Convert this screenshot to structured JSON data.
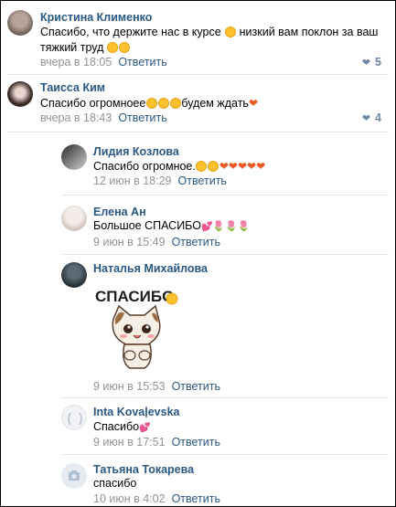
{
  "comments": [
    {
      "author": "Кристина Клименко",
      "text_line1": "Спасибо, что держите нас в курсе",
      "text_line1b": "низкий вам поклон за ваш",
      "text_line2": "тяжкий труд",
      "time": "вчера в 18:05",
      "reply": "Ответить",
      "likes": "5"
    },
    {
      "author": "Таисса Ким",
      "text_a": "Спасибо огромнoee",
      "text_b": "будем ждать",
      "time": "вчера в 18:43",
      "reply": "Ответить",
      "likes": "4"
    }
  ],
  "replies": [
    {
      "author": "Лидия Козлова",
      "text": "Спасибо огромное.",
      "time": "12 июн в 18:29",
      "reply": "Ответить"
    },
    {
      "author": "Елена Ан",
      "text": "Большое СПАСИБО",
      "time": "9 июн в 15:49",
      "reply": "Ответить"
    },
    {
      "author": "Наталья Михайлова",
      "sticker_text": "СПАСИБО",
      "time": "9 июн в 15:53",
      "reply": "Ответить"
    },
    {
      "author": "Inta Kovaļevska",
      "text": "Спасибо",
      "time": "9 июн в 17:51",
      "reply": "Ответить"
    },
    {
      "author": "Татьяна Токарева",
      "text": "спасибо",
      "time": "10 июн в 4:02",
      "reply": "Ответить"
    }
  ],
  "colors": {
    "link": "#2a5885",
    "meta": "#939393",
    "likes": "#6f87a4"
  }
}
